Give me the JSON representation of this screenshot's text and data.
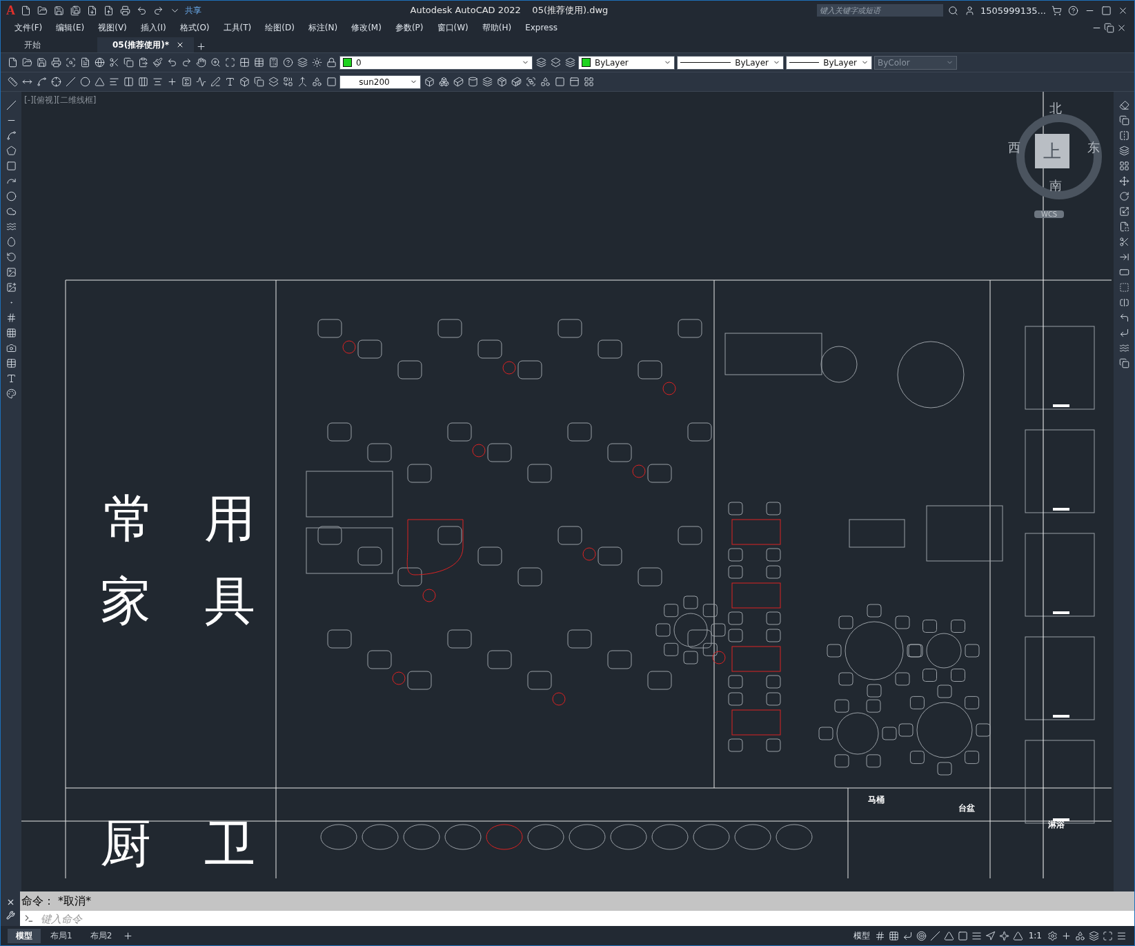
{
  "title_bar": {
    "app_letter": "A",
    "share": "共享",
    "title": "Autodesk AutoCAD 2022    05(推荐使用).dwg",
    "search": {
      "placeholder": "键入关键字或短语"
    },
    "user": "1505999135..."
  },
  "menu": [
    "文件(F)",
    "编辑(E)",
    "视图(V)",
    "插入(I)",
    "格式(O)",
    "工具(T)",
    "绘图(D)",
    "标注(N)",
    "修改(M)",
    "参数(P)",
    "窗口(W)",
    "帮助(H)",
    "Express"
  ],
  "doc_tabs": [
    {
      "label": "开始",
      "selected": false
    },
    {
      "label": "05(推荐使用)*",
      "selected": true
    }
  ],
  "properties": {
    "layer": "0",
    "color_setting": "ByLayer",
    "linetype": "ByLayer",
    "lineweight": "ByLayer",
    "plot_style": {
      "value": "ByColor",
      "disabled": true
    },
    "dim_style": "sun200"
  },
  "viewport_label": "[-][俯视][二维线框]",
  "viewcube": {
    "north": "北",
    "south": "南",
    "east": "东",
    "west": "西",
    "face": "上",
    "ucs": "WCS"
  },
  "drawing": {
    "section_labels": [
      "常",
      "用",
      "家",
      "具",
      "厨",
      "卫"
    ],
    "small_labels": [
      "马桶",
      "台盆",
      "淋浴"
    ]
  },
  "command": {
    "history": "命令： *取消*",
    "placeholder": "键入命令"
  },
  "layout_tabs": [
    {
      "label": "模型",
      "selected": true
    },
    {
      "label": "布局1",
      "selected": false
    },
    {
      "label": "布局2",
      "selected": false
    }
  ],
  "status_bar": {
    "space": "模型",
    "scale": "1:1"
  }
}
